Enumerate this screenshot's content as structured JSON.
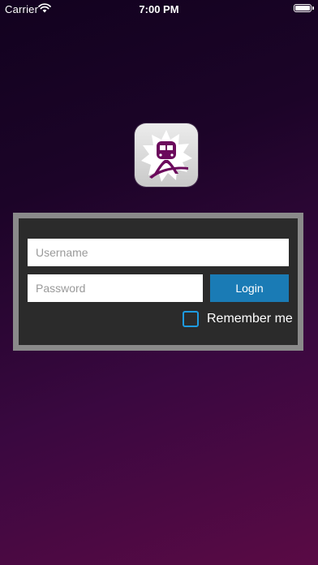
{
  "status_bar": {
    "carrier": "Carrier",
    "time": "7:00 PM",
    "battery_level": 1.0,
    "icons": [
      "wifi-icon",
      "battery-icon"
    ]
  },
  "logo": {
    "icon": "train-logo-icon",
    "colors": {
      "badge_background": "#d9d9d9",
      "starburst": "#ffffff",
      "train": "#6b0a5c"
    }
  },
  "login_form": {
    "username_placeholder": "Username",
    "username_value": "",
    "password_placeholder": "Password",
    "password_value": "",
    "login_label": "Login",
    "remember_label": "Remember me",
    "remember_checked": false
  },
  "colors": {
    "panel_background": "#2b2b2b",
    "panel_border": "#8a8a8a",
    "login_button": "#1a7bb5",
    "checkbox_border": "#1e9be0",
    "background_top": "#12021f",
    "background_bottom": "#5a0a45"
  }
}
